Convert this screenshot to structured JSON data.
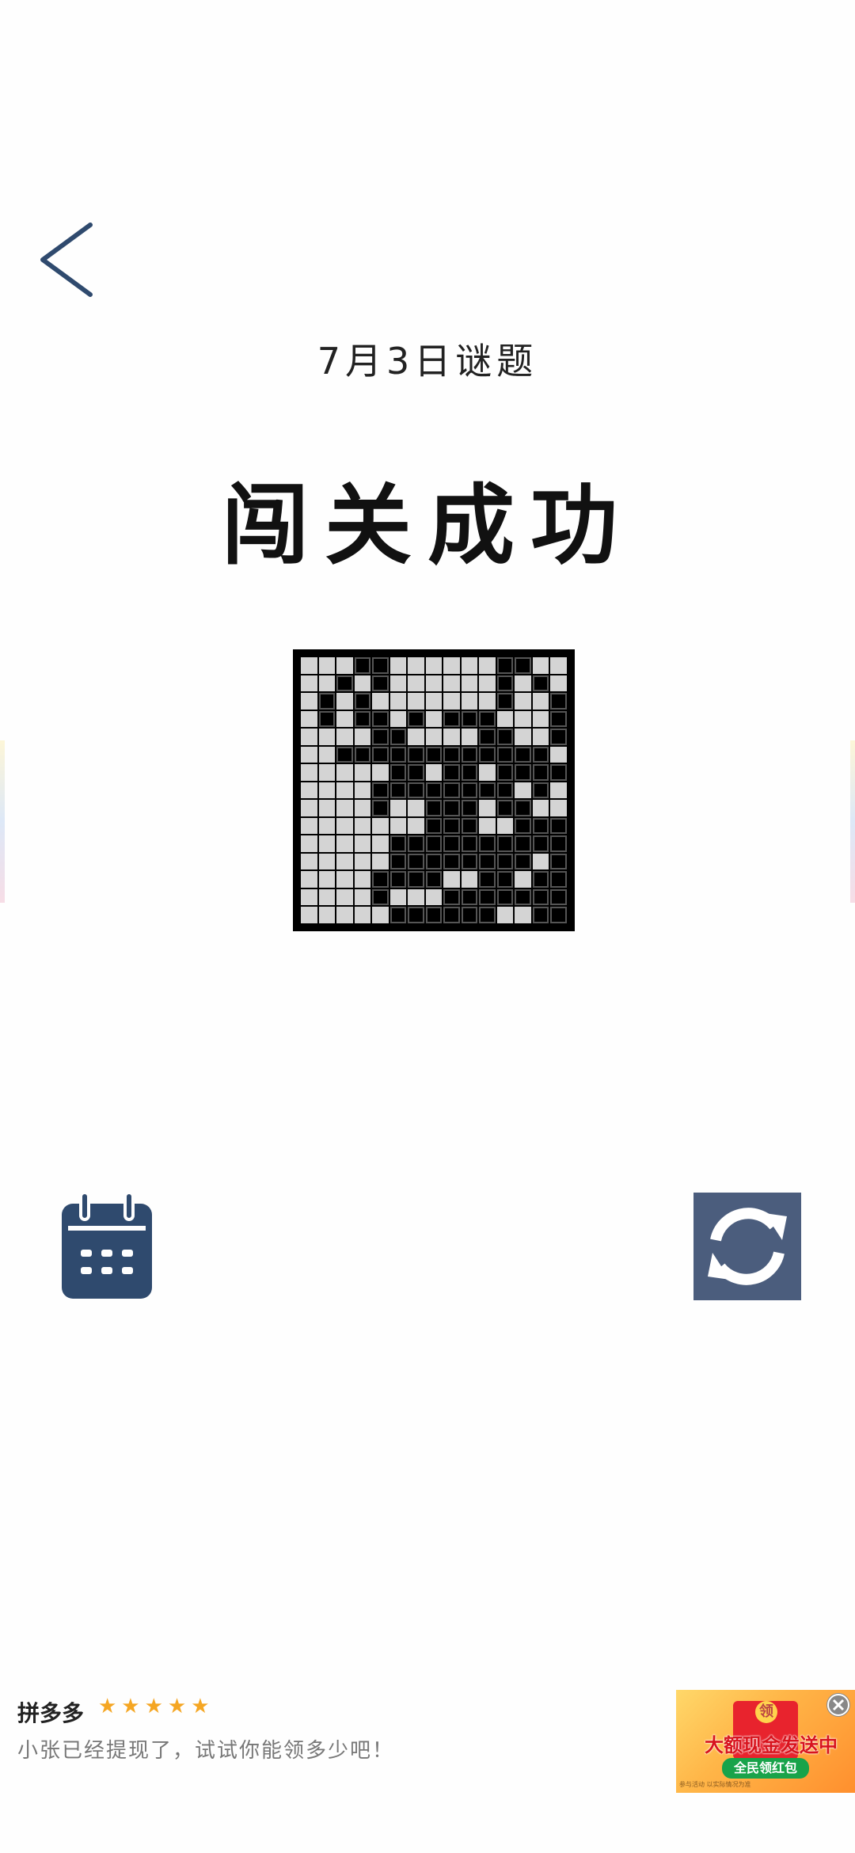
{
  "header": {
    "date_title": "7月3日谜题",
    "result_title": "闯关成功"
  },
  "icons": {
    "back": "chevron-left-icon",
    "calendar": "calendar-icon",
    "refresh": "refresh-icon",
    "close": "close-icon",
    "star": "star-icon"
  },
  "colors": {
    "accent": "#2f4a6e",
    "refresh_bg": "#4b5d7d",
    "grid_on": "#000000",
    "grid_off": "#d4d4d4"
  },
  "puzzle": {
    "rows": [
      "000110000001100",
      "001010000001010",
      "010100000001001",
      "010110101110001",
      "000011000011001",
      "001111111111110",
      "000001101101111",
      "000011111111010",
      "000010011101100",
      "000000011100111",
      "000001111111111",
      "000001111111101",
      "000011110011011",
      "000010001111111",
      "000001111110011"
    ]
  },
  "ad": {
    "brand": "拼多多",
    "rating_stars": 5,
    "stars": "★★★★★",
    "text": "小张已经提现了，试试你能领多少吧！",
    "headline": "大额现金发送中",
    "badge": "全民领红包",
    "coin": "领",
    "fineprint": "参与活动 以实际情况为准"
  }
}
